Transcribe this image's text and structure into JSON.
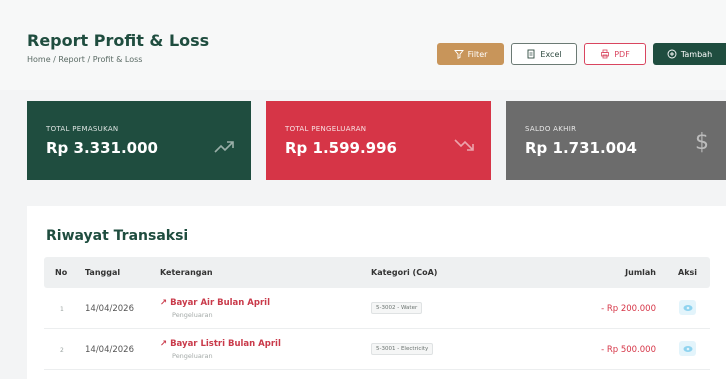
{
  "header": {
    "title": "Report Profit & Loss",
    "breadcrumb": "Home / Report / Profit & Loss"
  },
  "toolbar": {
    "filter_label": "Filter",
    "excel_label": "Excel",
    "pdf_label": "PDF",
    "add_label": "Tambah"
  },
  "summary": {
    "income": {
      "label": "TOTAL PEMASUKAN",
      "value": "Rp 3.331.000",
      "icon": "trending-up-icon"
    },
    "expense": {
      "label": "TOTAL PENGELUARAN",
      "value": "Rp 1.599.996",
      "icon": "trending-down-icon"
    },
    "balance": {
      "label": "SALDO AKHIR",
      "value": "Rp 1.731.004",
      "icon": "dollar-icon",
      "icon_glyph": "$"
    }
  },
  "transactions": {
    "title": "Riwayat Transaksi",
    "columns": [
      "No",
      "Tanggal",
      "Keterangan",
      "Kategori (CoA)",
      "Jumlah",
      "Aksi"
    ],
    "rows": [
      {
        "no": "1",
        "date": "14/04/2026",
        "description": "↗ Bayar Air Bulan April",
        "type": "Pengeluaran",
        "category": "5-3002 - Water",
        "amount": "- Rp 200.000"
      },
      {
        "no": "2",
        "date": "14/04/2026",
        "description": "↗ Bayar Listri Bulan April",
        "type": "Pengeluaran",
        "category": "5-3001 - Electricity",
        "amount": "- Rp 500.000"
      }
    ]
  },
  "colors": {
    "brand_green": "#1f4d3f",
    "expense_red": "#d63547",
    "balance_gray": "#6c6c6c",
    "filter_gold": "#c8955a"
  }
}
